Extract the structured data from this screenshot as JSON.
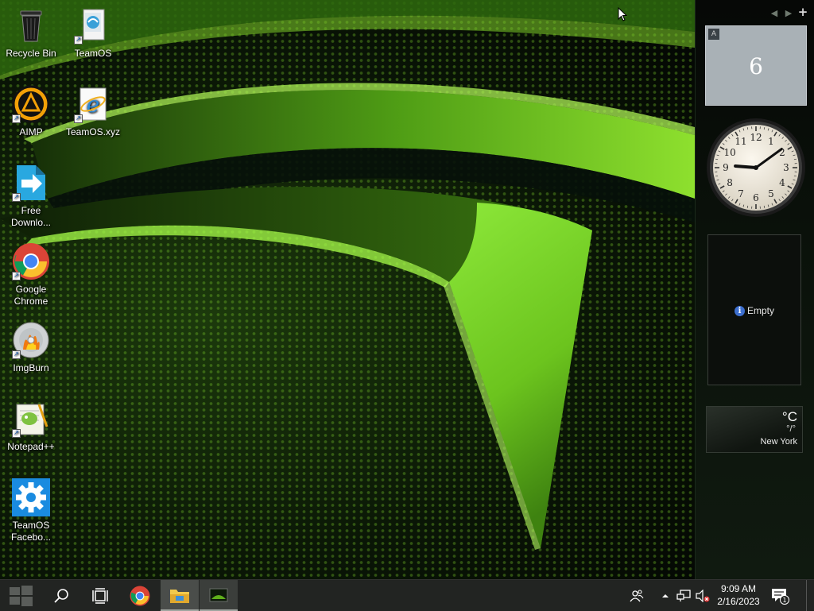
{
  "desktop_icons": [
    {
      "id": "recycle-bin",
      "label": "Recycle Bin"
    },
    {
      "id": "teamos",
      "label": "TeamOS"
    },
    {
      "id": "aimp",
      "label": "AIMP"
    },
    {
      "id": "teamos-xyz",
      "label": "TeamOS.xyz"
    },
    {
      "id": "free-download-manager",
      "label": "Free Downlo..."
    },
    {
      "id": "google-chrome",
      "label": "Google Chrome"
    },
    {
      "id": "imgburn",
      "label": "ImgBurn"
    },
    {
      "id": "notepad-plus-plus",
      "label": "Notepad++"
    },
    {
      "id": "teamos-facebook",
      "label": "TeamOS Facebo..."
    }
  ],
  "sidebar": {
    "nav": {
      "prev": "◀",
      "next": "▶",
      "add": "+"
    },
    "slideshow": {
      "corner_label": "A",
      "value": "6"
    },
    "clock": {
      "hour": 9,
      "minute": 9
    },
    "feed": {
      "status": "Empty",
      "info_glyph": "i"
    },
    "weather": {
      "temperature": "°C",
      "range": "°/°",
      "city": "New York"
    }
  },
  "taskbar": {
    "items": [
      {
        "name": "start-button",
        "icon": "windows-logo-icon"
      },
      {
        "name": "search-button",
        "icon": "search-icon"
      },
      {
        "name": "task-view-button",
        "icon": "task-view-icon"
      },
      {
        "name": "chrome-taskbar",
        "icon": "chrome-icon"
      },
      {
        "name": "file-explorer-taskbar",
        "icon": "folder-icon"
      },
      {
        "name": "app-taskbar",
        "icon": "app-icon"
      }
    ],
    "tray": {
      "people_icon": "people-icon",
      "chevron_icon": "chevron-up-icon",
      "network_icon": "network-icon",
      "volume_icon": "volume-muted-icon",
      "time": "9:09 AM",
      "date": "2/16/2023",
      "notification_count": "1"
    }
  },
  "colors": {
    "wallpaper_green": "#7ed321",
    "taskbar": "#222422",
    "sidebar": "#0a110a",
    "slideshow_bg": "#a9b1b6"
  }
}
